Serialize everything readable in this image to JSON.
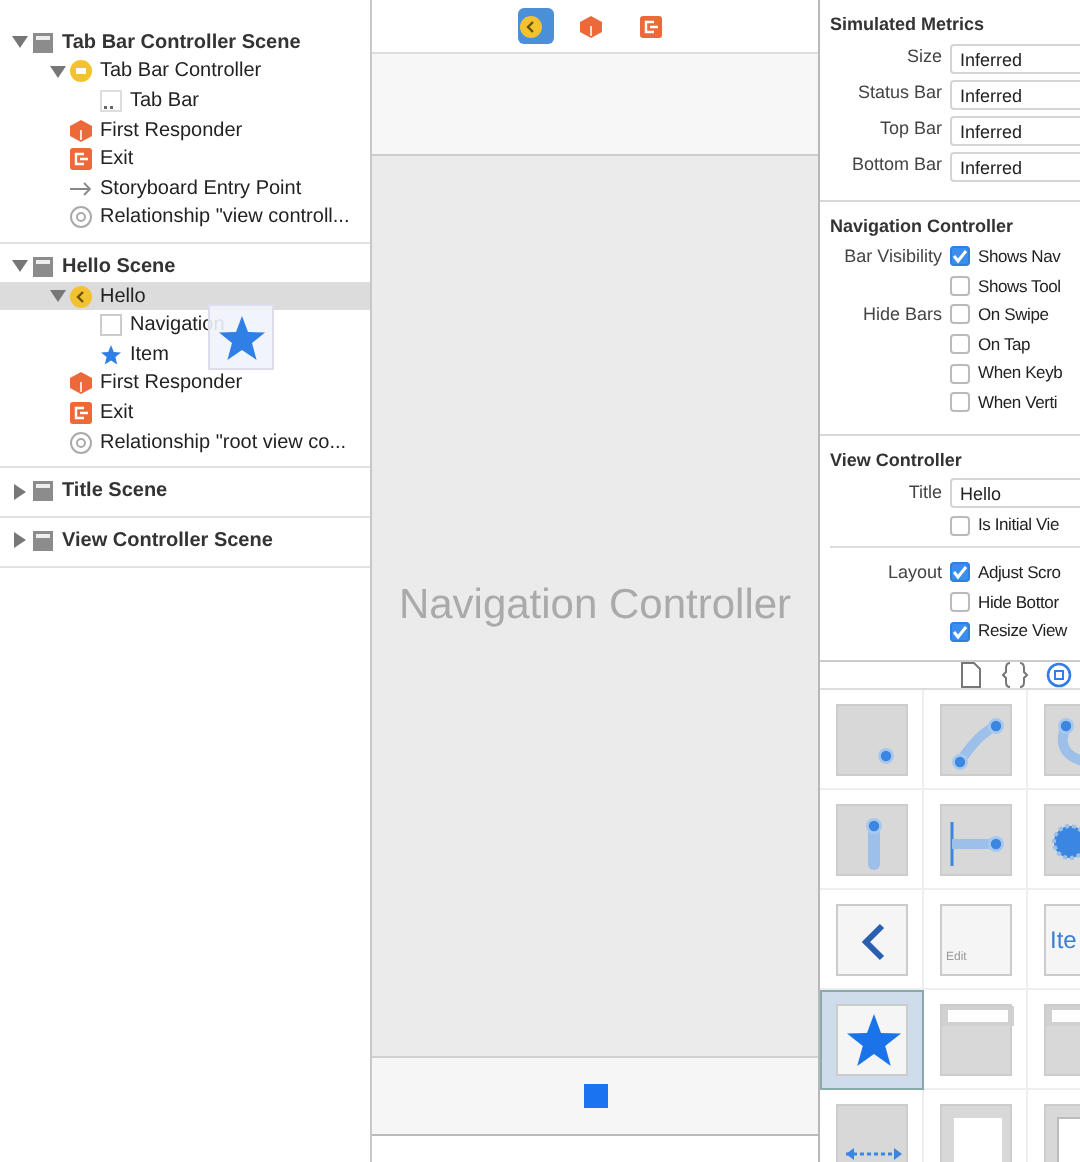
{
  "outline": {
    "scenes": [
      {
        "title": "Tab Bar Controller Scene",
        "expanded": true,
        "children": [
          {
            "label": "Tab Bar Controller",
            "kind": "tabbar-controller",
            "expanded": true,
            "selected": false,
            "children": [
              {
                "label": "Tab Bar",
                "kind": "tabbar",
                "selected": false
              }
            ]
          },
          {
            "label": "First Responder",
            "kind": "responder",
            "selected": false
          },
          {
            "label": "Exit",
            "kind": "exit",
            "selected": false
          },
          {
            "label": "Storyboard Entry Point",
            "kind": "entry",
            "selected": false
          },
          {
            "label": "Relationship \"view controll...",
            "kind": "relationship",
            "selected": false
          }
        ]
      },
      {
        "title": "Hello Scene",
        "expanded": true,
        "children": [
          {
            "label": "Hello",
            "kind": "nav-controller",
            "expanded": true,
            "selected": true,
            "children": [
              {
                "label": "Navigation",
                "kind": "navbar",
                "selected": false,
                "dragging": true
              },
              {
                "label": "Item",
                "kind": "item",
                "selected": false
              }
            ]
          },
          {
            "label": "First Responder",
            "kind": "responder",
            "selected": false
          },
          {
            "label": "Exit",
            "kind": "exit",
            "selected": false
          },
          {
            "label": "Relationship \"root view co...",
            "kind": "relationship",
            "selected": false
          }
        ]
      },
      {
        "title": "Title Scene",
        "expanded": false
      },
      {
        "title": "View Controller Scene",
        "expanded": false
      }
    ]
  },
  "canvas": {
    "dock": [
      {
        "kind": "nav-controller",
        "selected": true
      },
      {
        "kind": "responder",
        "selected": false
      },
      {
        "kind": "exit",
        "selected": false
      }
    ],
    "placeholder_title": "Navigation Controller"
  },
  "inspector": {
    "sections": [
      {
        "title": "Simulated Metrics",
        "rows": [
          {
            "kind": "popup",
            "label": "Size",
            "value": "Inferred"
          },
          {
            "kind": "popup",
            "label": "Status Bar",
            "value": "Inferred"
          },
          {
            "kind": "popup",
            "label": "Top Bar",
            "value": "Inferred"
          },
          {
            "kind": "popup",
            "label": "Bottom Bar",
            "value": "Inferred"
          }
        ]
      },
      {
        "title": "Navigation Controller",
        "rows": [
          {
            "kind": "check",
            "label": "Bar Visibility",
            "text": "Shows Nav",
            "checked": true
          },
          {
            "kind": "check",
            "text": "Shows Tool",
            "checked": false
          },
          {
            "kind": "check",
            "label": "Hide Bars",
            "text": "On Swipe",
            "checked": false
          },
          {
            "kind": "check",
            "text": "On Tap",
            "checked": false
          },
          {
            "kind": "check",
            "text": "When Keyb",
            "checked": false
          },
          {
            "kind": "check",
            "text": "When Verti",
            "checked": false
          }
        ]
      },
      {
        "title": "View Controller",
        "rows": [
          {
            "kind": "field",
            "label": "Title",
            "value": "Hello"
          },
          {
            "kind": "check",
            "text": "Is Initial Vie",
            "checked": false
          },
          {
            "kind": "divider"
          },
          {
            "kind": "check",
            "label": "Layout",
            "text": "Adjust Scro",
            "checked": true
          },
          {
            "kind": "check",
            "text": "Hide Bottor",
            "checked": false
          },
          {
            "kind": "check",
            "text": "Resize View",
            "checked": true
          }
        ]
      }
    ]
  },
  "library": {
    "tabs": [
      {
        "kind": "file",
        "selected": false
      },
      {
        "kind": "braces",
        "selected": false
      },
      {
        "kind": "object",
        "selected": true
      }
    ],
    "objects": [
      {
        "kind": "tap",
        "selected": false
      },
      {
        "kind": "pinch",
        "selected": false
      },
      {
        "kind": "rotate",
        "selected": false
      },
      {
        "kind": "swipe",
        "selected": false
      },
      {
        "kind": "pan",
        "selected": false
      },
      {
        "kind": "longpress",
        "selected": false
      },
      {
        "kind": "back",
        "selected": false
      },
      {
        "kind": "barbutton",
        "text": "Edit",
        "selected": false
      },
      {
        "kind": "textitem",
        "text": "Ite",
        "selected": false
      },
      {
        "kind": "star",
        "selected": true
      },
      {
        "kind": "search",
        "selected": false
      },
      {
        "kind": "searchdisplay",
        "selected": false
      },
      {
        "kind": "flexspace",
        "selected": false
      },
      {
        "kind": "view",
        "selected": false
      },
      {
        "kind": "container",
        "selected": false
      }
    ]
  }
}
